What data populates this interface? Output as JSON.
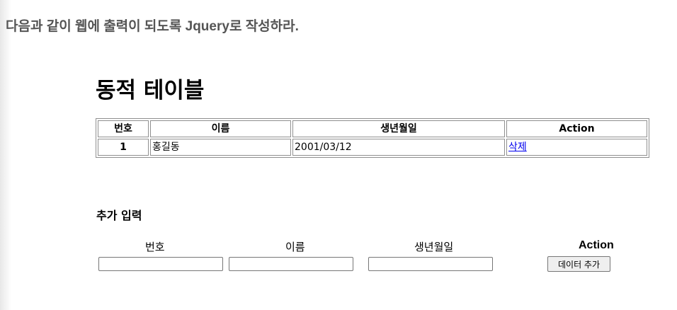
{
  "instruction": "다음과 같이 웹에 출력이 되도록 Jquery로 작성하라.",
  "page_title": "동적 테이블",
  "table": {
    "headers": [
      "번호",
      "이름",
      "생년월일",
      "Action"
    ],
    "rows": [
      {
        "num": "1",
        "name": "홍길동",
        "birth": "2001/03/12",
        "action": "삭제"
      }
    ]
  },
  "form": {
    "title": "추가 입력",
    "headers": [
      "번호",
      "이름",
      "생년월일",
      "Action"
    ],
    "inputs": [
      {
        "value": ""
      },
      {
        "value": ""
      },
      {
        "value": ""
      }
    ],
    "add_button": "데이터 추가"
  },
  "colors": {
    "link": "#0000ee",
    "instruction": "#555555",
    "border": "#8f8f8f"
  }
}
